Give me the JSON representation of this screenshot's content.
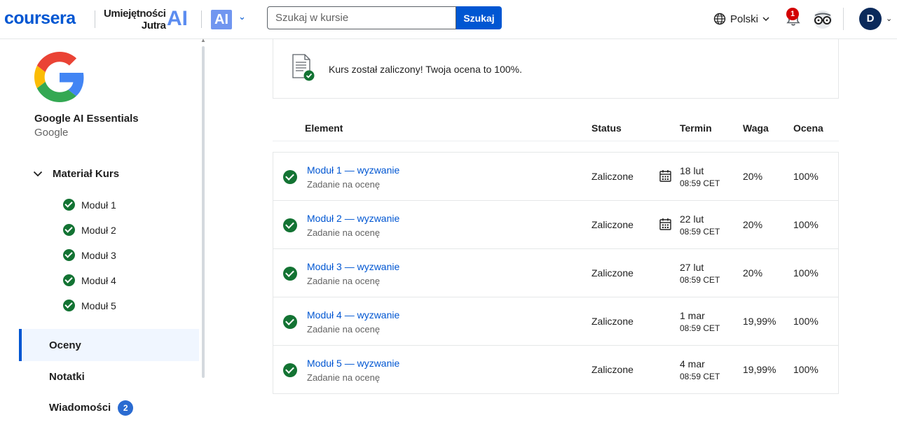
{
  "header": {
    "logo": "coursera",
    "brand_line1": "Umiejętności",
    "brand_line2": "Jutra",
    "brand_ai": "AI",
    "ai_badge": "AI",
    "search_placeholder": "Szukaj w kursie",
    "search_button": "Szukaj",
    "language": "Polski",
    "notification_count": "1",
    "avatar_initial": "D"
  },
  "sidebar": {
    "course_title": "Google AI Essentials",
    "course_org": "Google",
    "section_label": "Materiał Kurs",
    "modules": [
      "Moduł 1",
      "Moduł 2",
      "Moduł 3",
      "Moduł 4",
      "Moduł 5"
    ],
    "nav": {
      "grades": "Oceny",
      "notes": "Notatki",
      "messages": "Wiadomości",
      "messages_count": "2"
    }
  },
  "main": {
    "banner_text": "Kurs został zaliczony! Twoja ocena to 100%.",
    "columns": {
      "element": "Element",
      "status": "Status",
      "due": "Termin",
      "weight": "Waga",
      "grade": "Ocena"
    },
    "rows": [
      {
        "title": "Moduł 1 — wyzwanie",
        "subtitle": "Zadanie na ocenę",
        "status": "Zaliczone",
        "date": "18 lut",
        "time": "08:59 CET",
        "weight": "20%",
        "grade": "100%",
        "calendar": true
      },
      {
        "title": "Moduł 2 — wyzwanie",
        "subtitle": "Zadanie na ocenę",
        "status": "Zaliczone",
        "date": "22 lut",
        "time": "08:59 CET",
        "weight": "20%",
        "grade": "100%",
        "calendar": true
      },
      {
        "title": "Moduł 3 — wyzwanie",
        "subtitle": "Zadanie na ocenę",
        "status": "Zaliczone",
        "date": "27 lut",
        "time": "08:59 CET",
        "weight": "20%",
        "grade": "100%",
        "calendar": false
      },
      {
        "title": "Moduł 4 — wyzwanie",
        "subtitle": "Zadanie na ocenę",
        "status": "Zaliczone",
        "date": "1 mar",
        "time": "08:59 CET",
        "weight": "19,99%",
        "grade": "100%",
        "calendar": false
      },
      {
        "title": "Moduł 5 — wyzwanie",
        "subtitle": "Zadanie na ocenę",
        "status": "Zaliczone",
        "date": "4 mar",
        "time": "08:59 CET",
        "weight": "19,99%",
        "grade": "100%",
        "calendar": false
      }
    ]
  },
  "colors": {
    "brand_blue": "#0056d2",
    "success_green": "#137333",
    "notification_red": "#d30001",
    "avatar_navy": "#0b2a5b"
  }
}
